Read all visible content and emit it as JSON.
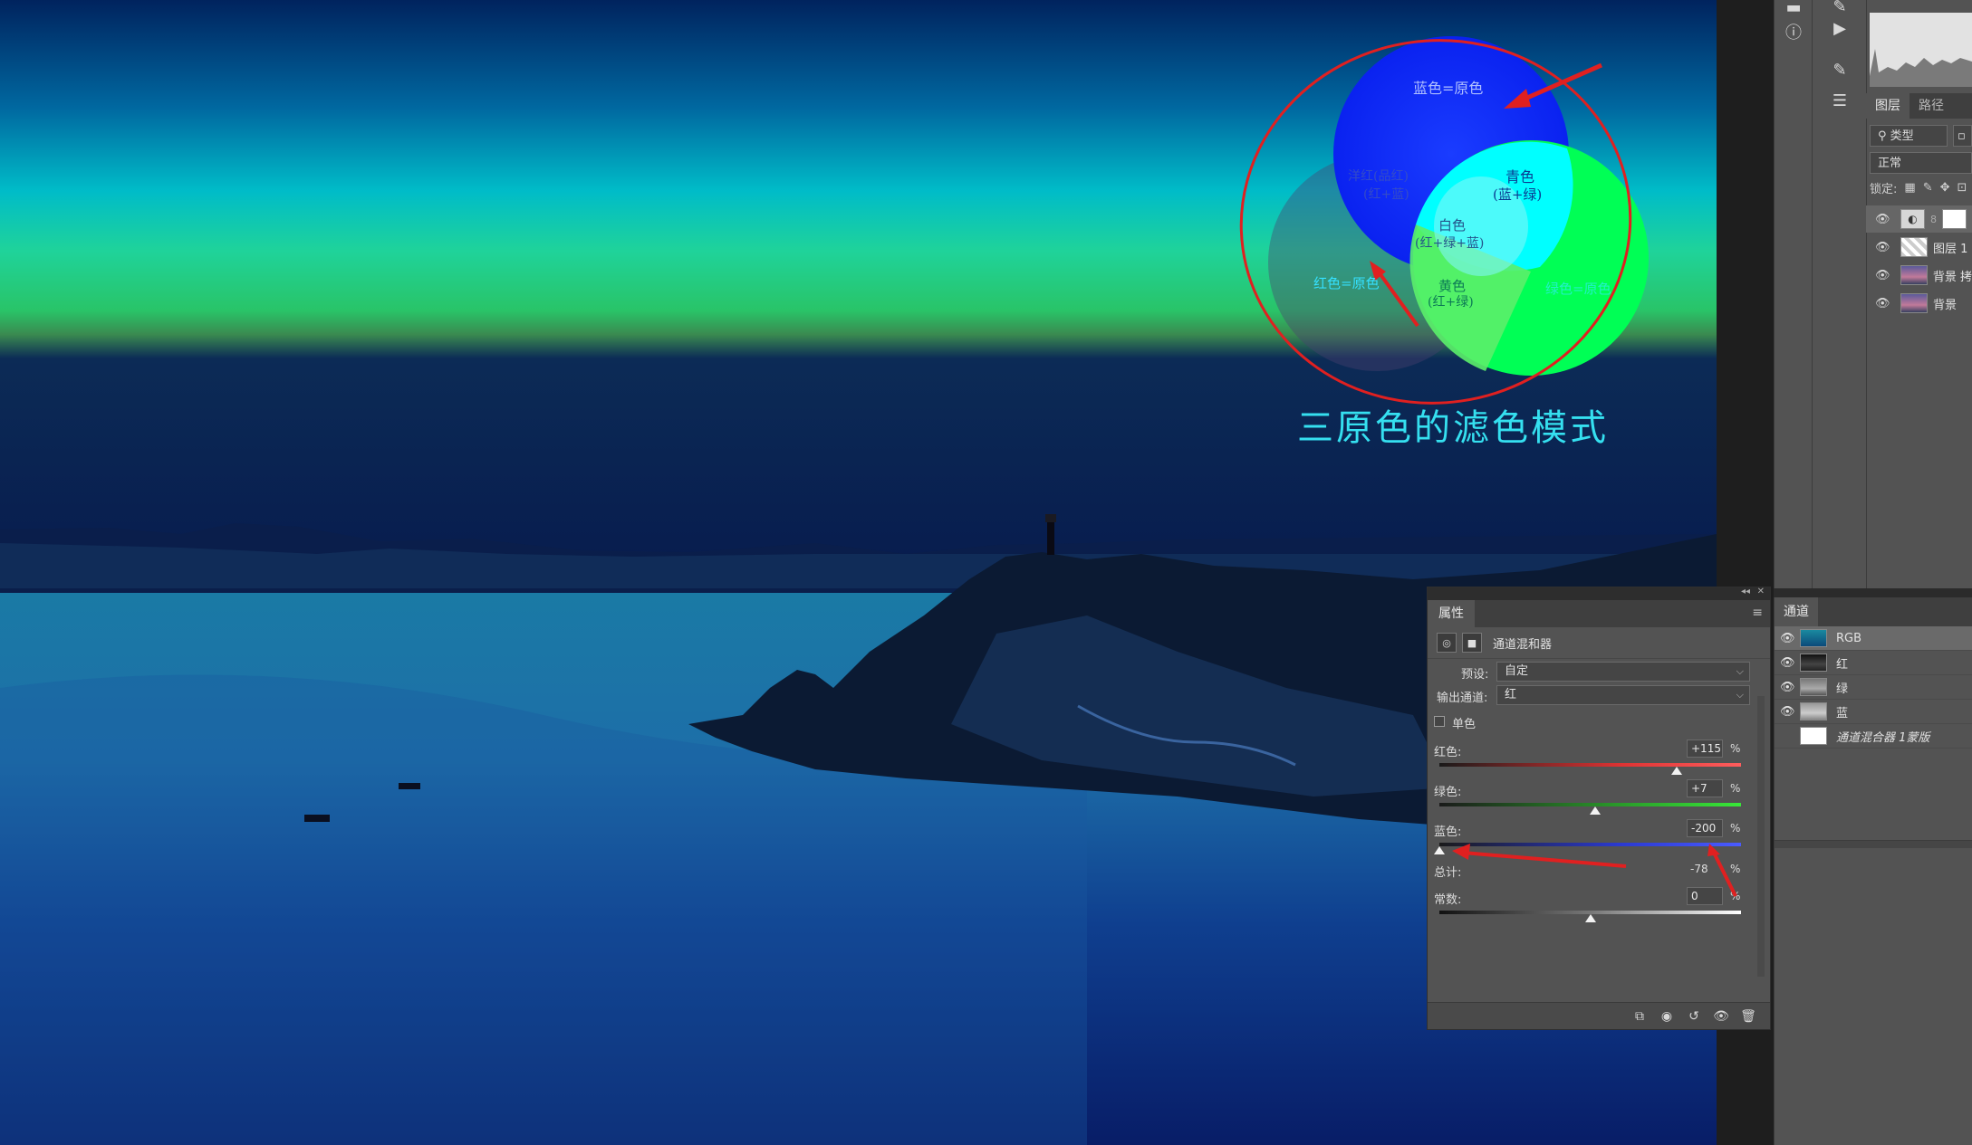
{
  "annotation": {
    "title": "三原色的滤色模式",
    "circle_labels": {
      "blue": "蓝色=原色",
      "red": "红色=原色",
      "green": "绿色=原色",
      "cyan": "青色",
      "cyan_mix": "(蓝+绿)",
      "magenta": "洋红(品红)",
      "magenta_mix": "(红+蓝)",
      "white": "白色",
      "white_mix": "(红+绿+蓝)",
      "yellow": "黄色",
      "yellow_mix": "(红+绿)"
    },
    "colors": {
      "blue": "#0033ff",
      "green": "#00ff55",
      "cyan": "#00ffff",
      "red_outline": "#e02020"
    }
  },
  "layers_panel": {
    "tabs": [
      "图层",
      "路径"
    ],
    "filter_label": "类型",
    "blend_mode": "正常",
    "lock_label": "锁定:",
    "layers": [
      {
        "name": "",
        "thumb": "adjustment"
      },
      {
        "name": "图层 1",
        "thumb": "checker"
      },
      {
        "name": "背景 拷",
        "thumb": "photo"
      },
      {
        "name": "背景",
        "thumb": "photo"
      }
    ]
  },
  "channels_panel": {
    "tab": "通道",
    "rows": [
      {
        "name": "RGB",
        "thumb": "rgb",
        "selected": true
      },
      {
        "name": "红",
        "thumb": "red",
        "selected": false
      },
      {
        "name": "绿",
        "thumb": "green",
        "selected": false
      },
      {
        "name": "蓝",
        "thumb": "blue",
        "selected": false
      },
      {
        "name": "通道混合器 1蒙版",
        "thumb": "mask",
        "selected": false
      }
    ]
  },
  "properties_panel": {
    "tab": "属性",
    "adjustment_title": "通道混和器",
    "preset_label": "预设:",
    "preset_value": "自定",
    "output_label": "输出通道:",
    "output_value": "红",
    "mono_label": "单色",
    "red_label": "红色:",
    "red_value": "+115",
    "green_label": "绿色:",
    "green_value": "+7",
    "blue_label": "蓝色:",
    "blue_value": "-200",
    "total_label": "总计:",
    "total_value": "-78",
    "constant_label": "常数:",
    "constant_value": "0",
    "percent": "%",
    "slider_levels": {
      "red": 115,
      "green": 7,
      "blue": -200,
      "constant": 0,
      "range": [
        -200,
        200
      ]
    }
  }
}
